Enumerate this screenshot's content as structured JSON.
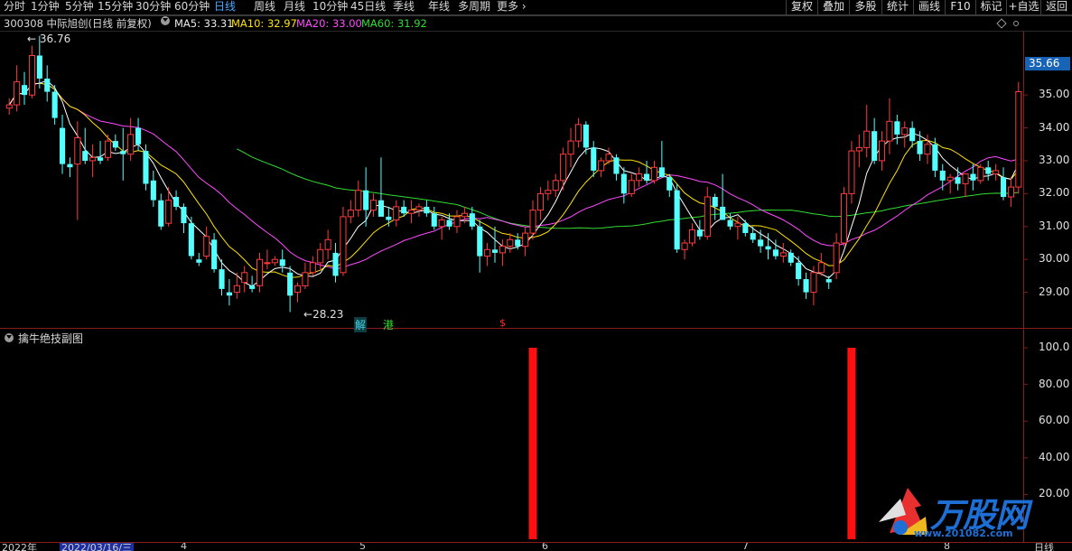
{
  "toolbar": {
    "periods": [
      "分时",
      "1分钟",
      "5分钟",
      "15分钟",
      "30分钟",
      "60分钟",
      "日线",
      "周线",
      "月线",
      "10分钟",
      "45日线",
      "季线",
      "年线",
      "多周期",
      "更多"
    ],
    "active_period": "日线",
    "right_buttons": [
      "复权",
      "叠加",
      "多股",
      "统计",
      "画线",
      "F10",
      "标记",
      "+自选",
      "返回"
    ]
  },
  "info": {
    "code_name": "300308 中际旭创(日线 前复权)",
    "ma5": "MA5: 33.31",
    "ma10": "MA10: 32.97",
    "ma20": "MA20: 33.00",
    "ma60": "MA60: 31.92"
  },
  "main_chart": {
    "high_label": "36.76",
    "low_label": "28.23",
    "current_price": "35.66",
    "y_ticks": [
      "35.00",
      "34.00",
      "33.00",
      "32.00",
      "31.00",
      "30.00",
      "29.00"
    ],
    "y_range": [
      28.0,
      36.9
    ],
    "markers": [
      {
        "text": "解",
        "color": "#46d2e6"
      },
      {
        "text": "港",
        "color": "#32dc32"
      },
      {
        "text": "$",
        "color": "#ff2a2a"
      }
    ],
    "colors": {
      "up": "#ff3c3c",
      "down": "#54ffff",
      "ma5": "#ffffff",
      "ma10": "#ffe100",
      "ma20": "#ff4aff",
      "ma60": "#32dc32"
    }
  },
  "sub_chart": {
    "title": "擒牛绝技副图",
    "y_ticks": [
      "100.0",
      "80.00",
      "60.00",
      "40.00",
      "20.00"
    ],
    "y_range": [
      0,
      100
    ],
    "signals": [
      {
        "value": 100
      },
      {
        "value": 100
      }
    ]
  },
  "bottom_axis": {
    "labels": [
      "2022年",
      "2022/03/16/三",
      "4",
      "5",
      "6",
      "7",
      "8",
      "日线"
    ]
  },
  "watermark": {
    "brand": "万股网",
    "url": "www.201082.com"
  },
  "chart_data": {
    "type": "candlestick",
    "title": "300308 中际旭创(日线 前复权)",
    "ylim": [
      28.0,
      36.9
    ],
    "candles": [
      [
        34.6,
        34.9,
        34.4,
        34.7
      ],
      [
        34.7,
        35.9,
        34.5,
        35.4
      ],
      [
        35.3,
        35.7,
        34.7,
        35.0
      ],
      [
        35.0,
        36.5,
        34.9,
        36.2
      ],
      [
        36.2,
        36.8,
        35.2,
        35.5
      ],
      [
        35.5,
        35.9,
        34.8,
        35.1
      ],
      [
        35.1,
        35.3,
        34.1,
        34.3
      ],
      [
        34.0,
        34.4,
        32.6,
        32.9
      ],
      [
        32.9,
        33.1,
        32.5,
        32.8
      ],
      [
        32.9,
        34.2,
        31.2,
        33.7
      ],
      [
        33.3,
        34.0,
        32.9,
        33.0
      ],
      [
        33.0,
        33.5,
        32.5,
        33.1
      ],
      [
        33.1,
        33.6,
        32.9,
        33.0
      ],
      [
        33.1,
        33.8,
        33.0,
        33.6
      ],
      [
        33.6,
        33.8,
        33.3,
        33.4
      ],
      [
        33.3,
        34.0,
        32.4,
        33.2
      ],
      [
        33.2,
        34.3,
        33.0,
        33.8
      ],
      [
        34.0,
        34.3,
        33.3,
        33.5
      ],
      [
        33.3,
        33.5,
        32.1,
        32.3
      ],
      [
        32.4,
        32.7,
        31.6,
        31.8
      ],
      [
        31.8,
        32.0,
        30.9,
        31.0
      ],
      [
        31.1,
        32.2,
        31.0,
        31.8
      ],
      [
        31.9,
        32.1,
        31.5,
        31.6
      ],
      [
        31.6,
        31.7,
        30.8,
        31.1
      ],
      [
        31.1,
        31.3,
        30.0,
        30.1
      ],
      [
        30.0,
        30.2,
        29.8,
        29.9
      ],
      [
        30.1,
        31.0,
        30.0,
        30.7
      ],
      [
        30.6,
        30.8,
        29.6,
        29.7
      ],
      [
        29.7,
        30.0,
        28.9,
        29.1
      ],
      [
        29.0,
        29.4,
        28.6,
        28.9
      ],
      [
        29.0,
        29.6,
        28.8,
        29.2
      ],
      [
        29.3,
        29.8,
        29.0,
        29.6
      ],
      [
        29.2,
        29.5,
        29.0,
        29.1
      ],
      [
        29.2,
        30.2,
        29.0,
        30.0
      ],
      [
        29.9,
        30.3,
        29.7,
        29.9
      ],
      [
        29.9,
        30.1,
        29.8,
        30.0
      ],
      [
        30.0,
        30.3,
        29.6,
        29.8
      ],
      [
        29.6,
        29.8,
        28.4,
        28.9
      ],
      [
        29.0,
        29.3,
        28.7,
        29.2
      ],
      [
        29.2,
        29.9,
        29.1,
        29.6
      ],
      [
        29.6,
        30.1,
        29.5,
        29.9
      ],
      [
        29.9,
        30.5,
        29.7,
        30.3
      ],
      [
        30.3,
        30.9,
        30.0,
        30.6
      ],
      [
        30.2,
        30.5,
        29.3,
        29.5
      ],
      [
        29.6,
        31.6,
        29.5,
        31.3
      ],
      [
        31.3,
        31.8,
        31.1,
        31.5
      ],
      [
        31.5,
        32.4,
        31.3,
        32.1
      ],
      [
        32.1,
        32.8,
        31.0,
        31.5
      ],
      [
        31.5,
        32.0,
        31.3,
        31.8
      ],
      [
        31.8,
        33.1,
        31.5,
        31.3
      ],
      [
        31.3,
        31.6,
        31.0,
        31.2
      ],
      [
        31.2,
        31.8,
        31.0,
        31.6
      ],
      [
        31.6,
        31.8,
        31.3,
        31.4
      ],
      [
        31.4,
        31.8,
        31.1,
        31.5
      ],
      [
        31.5,
        31.7,
        31.3,
        31.6
      ],
      [
        31.6,
        31.8,
        31.3,
        31.4
      ],
      [
        31.4,
        31.6,
        30.9,
        31.0
      ],
      [
        31.0,
        31.3,
        30.6,
        31.2
      ],
      [
        31.2,
        31.4,
        30.9,
        31.0
      ],
      [
        31.0,
        31.5,
        30.8,
        31.3
      ],
      [
        31.3,
        31.6,
        31.1,
        31.4
      ],
      [
        31.4,
        31.6,
        30.9,
        31.0
      ],
      [
        31.0,
        31.2,
        29.6,
        30.1
      ],
      [
        30.1,
        30.5,
        29.8,
        30.3
      ],
      [
        30.3,
        31.0,
        29.9,
        30.2
      ],
      [
        30.2,
        30.6,
        29.8,
        30.4
      ],
      [
        30.4,
        30.8,
        30.2,
        30.6
      ],
      [
        30.6,
        30.8,
        30.3,
        30.4
      ],
      [
        30.4,
        31.0,
        30.1,
        30.8
      ],
      [
        30.8,
        31.8,
        30.6,
        31.5
      ],
      [
        31.5,
        32.2,
        31.2,
        32.0
      ],
      [
        32.0,
        32.4,
        31.8,
        32.1
      ],
      [
        32.1,
        32.6,
        31.9,
        32.4
      ],
      [
        32.4,
        33.4,
        32.1,
        33.2
      ],
      [
        33.2,
        34.0,
        32.8,
        33.6
      ],
      [
        33.6,
        34.3,
        33.4,
        34.1
      ],
      [
        34.1,
        34.2,
        33.2,
        33.4
      ],
      [
        33.4,
        33.6,
        32.5,
        32.7
      ],
      [
        32.7,
        33.1,
        32.5,
        33.0
      ],
      [
        33.0,
        33.4,
        32.9,
        33.2
      ],
      [
        33.1,
        33.2,
        32.4,
        32.6
      ],
      [
        32.6,
        32.8,
        31.7,
        32.0
      ],
      [
        32.0,
        32.6,
        31.9,
        32.4
      ],
      [
        32.4,
        32.8,
        32.2,
        32.6
      ],
      [
        32.6,
        33.0,
        32.3,
        32.4
      ],
      [
        32.4,
        33.0,
        32.3,
        32.8
      ],
      [
        32.8,
        33.6,
        32.6,
        32.5
      ],
      [
        32.5,
        32.6,
        31.9,
        32.1
      ],
      [
        32.1,
        32.3,
        30.2,
        30.3
      ],
      [
        30.3,
        30.6,
        30.0,
        30.5
      ],
      [
        30.5,
        31.1,
        30.4,
        30.9
      ],
      [
        30.9,
        31.2,
        30.6,
        30.7
      ],
      [
        30.7,
        32.2,
        30.6,
        31.9
      ],
      [
        31.9,
        32.0,
        31.2,
        31.6
      ],
      [
        31.6,
        32.6,
        31.5,
        31.2
      ],
      [
        31.2,
        31.4,
        30.9,
        31.0
      ],
      [
        31.0,
        31.3,
        30.6,
        31.1
      ],
      [
        31.1,
        31.2,
        30.7,
        30.8
      ],
      [
        30.8,
        31.0,
        30.5,
        30.6
      ],
      [
        30.6,
        30.9,
        30.2,
        30.4
      ],
      [
        30.4,
        30.8,
        30.0,
        30.3
      ],
      [
        30.3,
        30.6,
        30.0,
        30.1
      ],
      [
        30.1,
        30.5,
        29.9,
        30.2
      ],
      [
        30.2,
        30.3,
        29.8,
        29.9
      ],
      [
        29.9,
        30.1,
        29.2,
        29.4
      ],
      [
        29.4,
        29.6,
        28.8,
        29.0
      ],
      [
        29.0,
        29.8,
        28.6,
        29.6
      ],
      [
        29.6,
        30.2,
        29.5,
        29.9
      ],
      [
        29.4,
        29.5,
        29.1,
        29.3
      ],
      [
        29.6,
        30.8,
        29.4,
        30.5
      ],
      [
        30.5,
        32.2,
        30.4,
        32.0
      ],
      [
        32.0,
        33.6,
        31.7,
        33.3
      ],
      [
        33.3,
        33.8,
        32.8,
        33.4
      ],
      [
        33.4,
        34.7,
        33.1,
        33.9
      ],
      [
        33.9,
        34.3,
        32.9,
        33.0
      ],
      [
        33.0,
        33.9,
        32.7,
        33.6
      ],
      [
        33.6,
        34.9,
        33.2,
        34.2
      ],
      [
        34.2,
        34.4,
        33.5,
        33.8
      ],
      [
        33.8,
        34.2,
        33.4,
        34.0
      ],
      [
        34.0,
        34.2,
        33.4,
        33.6
      ],
      [
        33.6,
        33.9,
        33.0,
        33.2
      ],
      [
        33.2,
        33.8,
        32.9,
        33.5
      ],
      [
        33.5,
        33.7,
        32.5,
        32.7
      ],
      [
        32.7,
        32.9,
        32.1,
        32.4
      ],
      [
        32.4,
        32.6,
        32.0,
        32.5
      ],
      [
        32.5,
        32.8,
        32.1,
        32.3
      ],
      [
        32.3,
        32.6,
        31.9,
        32.6
      ],
      [
        32.6,
        32.9,
        32.1,
        32.4
      ],
      [
        32.4,
        32.9,
        32.3,
        32.8
      ],
      [
        32.8,
        33.0,
        32.4,
        32.6
      ],
      [
        32.6,
        32.9,
        32.4,
        32.7
      ],
      [
        32.5,
        32.8,
        31.8,
        31.9
      ],
      [
        31.9,
        32.5,
        31.6,
        32.2
      ],
      [
        32.2,
        35.4,
        32.0,
        35.1
      ]
    ],
    "sub_signals": [
      {
        "index": 69,
        "value": 100
      },
      {
        "index": 111,
        "value": 100
      }
    ]
  }
}
